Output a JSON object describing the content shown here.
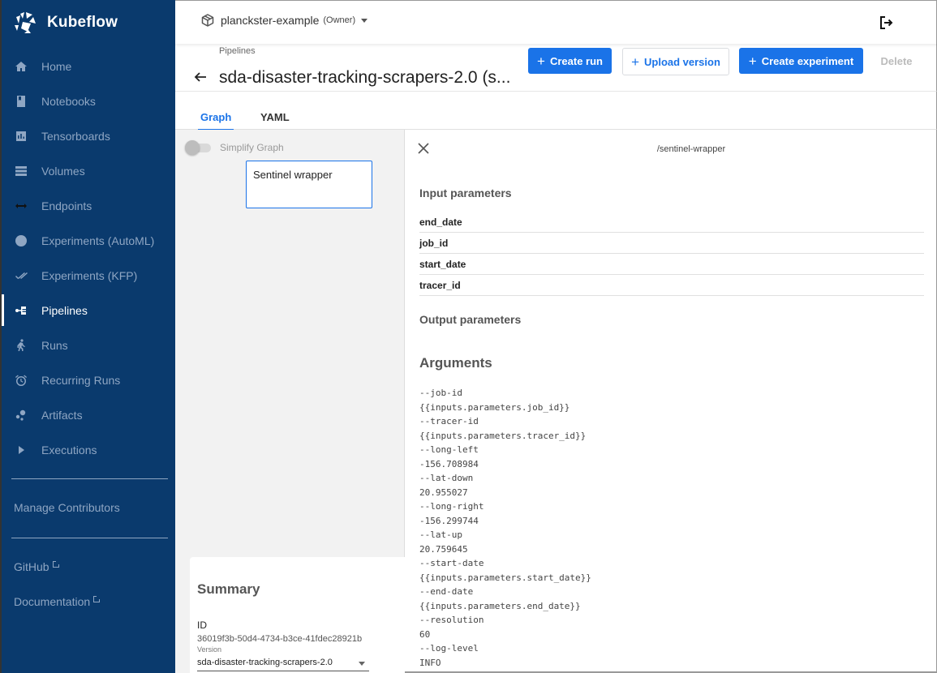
{
  "app": {
    "brand": "Kubeflow"
  },
  "sidebar": {
    "items": [
      {
        "label": "Home",
        "icon": "home-icon",
        "active": false
      },
      {
        "label": "Notebooks",
        "icon": "notebook-icon",
        "active": false
      },
      {
        "label": "Tensorboards",
        "icon": "tensorboard-icon",
        "active": false
      },
      {
        "label": "Volumes",
        "icon": "volumes-icon",
        "active": false
      },
      {
        "label": "Endpoints",
        "icon": "endpoints-icon",
        "active": false
      },
      {
        "label": "Experiments (AutoML)",
        "icon": "automl-icon",
        "active": false
      },
      {
        "label": "Experiments (KFP)",
        "icon": "kfp-icon",
        "active": false
      },
      {
        "label": "Pipelines",
        "icon": "pipelines-icon",
        "active": true
      },
      {
        "label": "Runs",
        "icon": "runs-icon",
        "active": false
      },
      {
        "label": "Recurring Runs",
        "icon": "alarm-icon",
        "active": false
      },
      {
        "label": "Artifacts",
        "icon": "artifacts-icon",
        "active": false
      },
      {
        "label": "Executions",
        "icon": "play-icon",
        "active": false
      }
    ],
    "manage_contributors": "Manage Contributors",
    "github": "GitHub",
    "documentation": "Documentation"
  },
  "topbar": {
    "namespace": "planckster-example",
    "role": "(Owner)"
  },
  "header": {
    "breadcrumb": "Pipelines",
    "title": "sda-disaster-tracking-scrapers-2.0 (s...",
    "buttons": {
      "create_run": "Create run",
      "upload_version": "Upload version",
      "create_experiment": "Create experiment",
      "delete": "Delete"
    }
  },
  "tabs": [
    {
      "label": "Graph",
      "active": true
    },
    {
      "label": "YAML",
      "active": false
    }
  ],
  "graph": {
    "simplify_label": "Simplify Graph",
    "simplify_on": false,
    "nodes": [
      {
        "label": "Sentinel wrapper"
      }
    ]
  },
  "summary": {
    "title": "Summary",
    "id_label": "ID",
    "id": "36019f3b-50d4-4734-b3ce-41fdec28921b",
    "version_label": "Version",
    "version": "sda-disaster-tracking-scrapers-2.0"
  },
  "details": {
    "node_path": "/sentinel-wrapper",
    "input_title": "Input parameters",
    "inputs": [
      "end_date",
      "job_id",
      "start_date",
      "tracer_id"
    ],
    "output_title": "Output parameters",
    "arguments_title": "Arguments",
    "arguments": [
      "--job-id",
      "{{inputs.parameters.job_id}}",
      "--tracer-id",
      "{{inputs.parameters.tracer_id}}",
      "--long-left",
      "-156.708984",
      "--lat-down",
      "20.955027",
      "--long-right",
      "-156.299744",
      "--lat-up",
      "20.759645",
      "--start-date",
      "{{inputs.parameters.start_date}}",
      "--end-date",
      "{{inputs.parameters.end_date}}",
      "--resolution",
      "60",
      "--log-level",
      "INFO"
    ]
  },
  "colors": {
    "sidebar_bg": "#0a3a6d",
    "sidebar_text": "#8fa6c3",
    "accent": "#1a73e8"
  }
}
